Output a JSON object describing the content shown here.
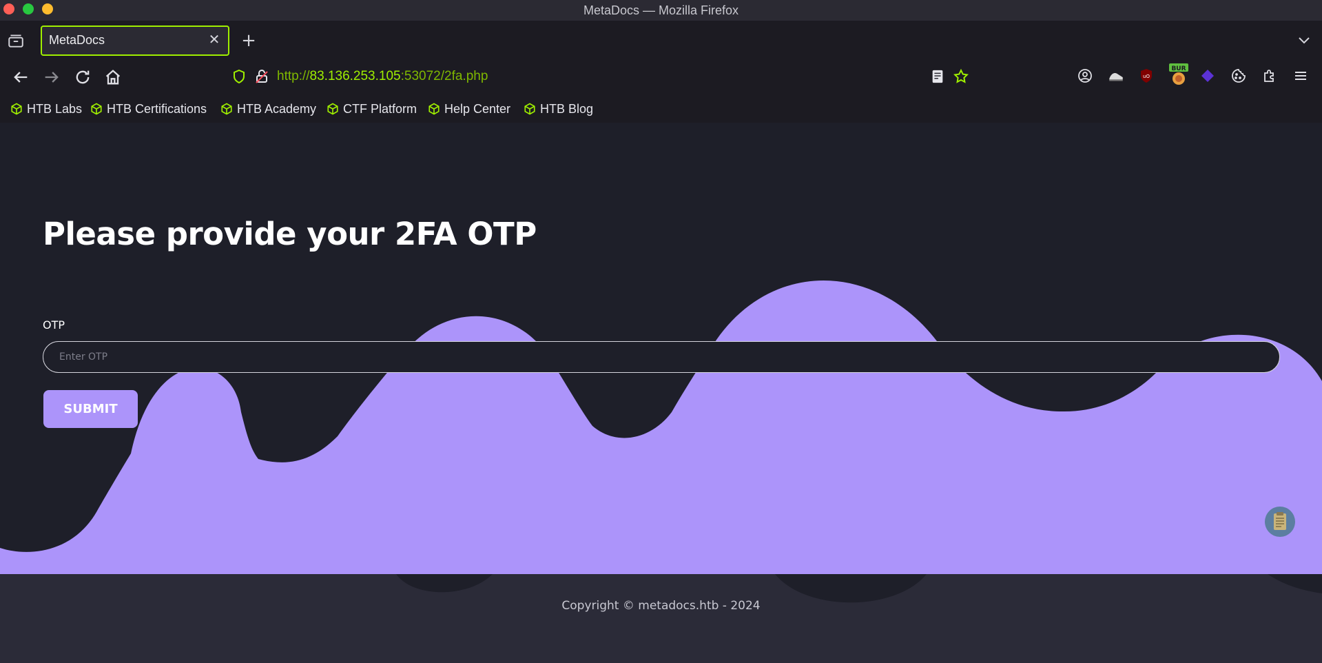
{
  "window": {
    "title": "MetaDocs — Mozilla Firefox"
  },
  "tabs": [
    {
      "label": "MetaDocs",
      "active": true
    }
  ],
  "toolbar": {
    "url_scheme": "http://",
    "url_host": "83.136.253.105",
    "url_path": ":53072/2fa.php"
  },
  "bookmarks": [
    {
      "label": "HTB Labs"
    },
    {
      "label": "HTB Certifications"
    },
    {
      "label": "HTB Academy"
    },
    {
      "label": "CTF Platform"
    },
    {
      "label": "Help Center"
    },
    {
      "label": "HTB Blog"
    }
  ],
  "page": {
    "heading": "Please provide your 2FA OTP",
    "otp_label": "OTP",
    "otp_placeholder": "Enter OTP",
    "otp_value": "",
    "submit_label": "SUBMIT",
    "copyright": "Copyright © metadocs.htb - 2024"
  },
  "colors": {
    "accent": "#9fef00",
    "wave": "#ac94fa",
    "background": "#1e1f29",
    "footer": "#2b2b38"
  },
  "icons": {
    "tab_list": "tab-list-icon",
    "close": "close-icon",
    "new_tab": "plus-icon",
    "back": "back-arrow-icon",
    "forward": "forward-arrow-icon",
    "reload": "reload-icon",
    "home": "home-icon",
    "shield": "shield-icon",
    "lock": "insecure-lock-icon",
    "reader": "reader-view-icon",
    "bookmark_star": "star-icon",
    "bookmark_item": "htb-cube-icon",
    "menu": "hamburger-menu-icon"
  }
}
